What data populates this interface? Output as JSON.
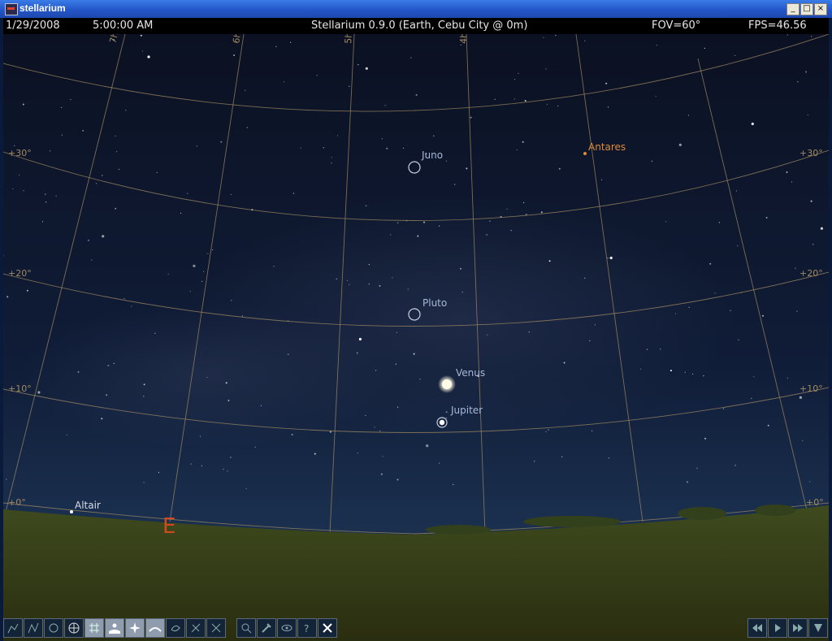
{
  "window": {
    "title": "stellarium",
    "minimize": "_",
    "maximize": "□",
    "close": "×"
  },
  "status": {
    "date": "1/29/2008",
    "time": "5:00:00 AM",
    "location": "Stellarium 0.9.0 (Earth, Cebu City @ 0m)",
    "fov": "FOV=60°",
    "fps": "FPS=46.56"
  },
  "colors": {
    "sky_top": "#0b1122",
    "sky_bottom": "#1a3050",
    "grid_line": "#a08a62",
    "planet_label": "#a8b8d8",
    "antares_label": "#e08a3a",
    "cardinal": "#d04a20",
    "ground": "#3a4218"
  },
  "sky": {
    "grid_labels_left": [
      "+30°",
      "+20°",
      "+10°",
      "+0°"
    ],
    "grid_labels_right": [
      "+30°",
      "+20°",
      "+10°",
      "+0°"
    ],
    "hour_labels": [
      "7h",
      "6h",
      "5h",
      "4h"
    ],
    "objects": {
      "juno": "Juno",
      "antares": "Antares",
      "pluto": "Pluto",
      "venus": "Venus",
      "jupiter": "Jupiter",
      "altair": "Altair"
    },
    "cardinal_east": "E"
  },
  "toolbar": {
    "buttons": [
      "constellation-lines-icon",
      "constellation-art-icon",
      "constellation-names-icon",
      "equatorial-grid-icon",
      "azimuthal-grid-icon",
      "ground-icon",
      "cardinal-points-icon",
      "atmosphere-icon",
      "nebulae-icon",
      "equatorial-mount-icon",
      "center-selected-icon",
      "search-icon",
      "configuration-icon",
      "night-mode-icon",
      "help-icon",
      "quit-icon"
    ],
    "active": [
      "azimuthal-grid-icon",
      "ground-icon",
      "cardinal-points-icon",
      "atmosphere-icon"
    ],
    "time_buttons": [
      "rewind-icon",
      "play-icon",
      "fast-forward-icon",
      "real-time-icon"
    ]
  }
}
